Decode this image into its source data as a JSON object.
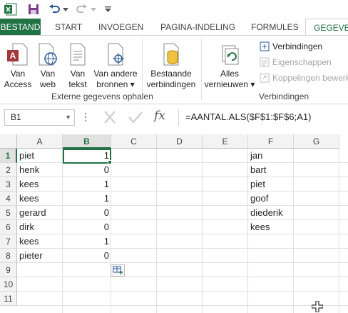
{
  "quick_access": {
    "icons": [
      "excel-icon",
      "save-icon",
      "undo-icon",
      "redo-icon",
      "customize-icon"
    ]
  },
  "tabs": [
    {
      "label": "BESTAND"
    },
    {
      "label": "START"
    },
    {
      "label": "INVOEGEN"
    },
    {
      "label": "PAGINA-INDELING"
    },
    {
      "label": "FORMULES"
    },
    {
      "label": "GEGEVEN"
    }
  ],
  "ribbon": {
    "van_access": [
      "Van",
      "Access"
    ],
    "van_web": [
      "Van",
      "web"
    ],
    "van_tekst": [
      "Van",
      "tekst"
    ],
    "van_andere": [
      "Van andere",
      "bronnen ▾"
    ],
    "bestaande": [
      "Bestaande",
      "verbindingen"
    ],
    "group_external": "Externe gegevens ophalen",
    "alles": [
      "Alles",
      "vernieuwen ▾"
    ],
    "verbindingen": "Verbindingen",
    "eigenschappen": "Eigenschappen",
    "koppelingen": "Koppelingen bewerk",
    "group_connections": "Verbindingen",
    "accent": "#217346"
  },
  "formula_bar": {
    "name_box": "B1",
    "formula": "=AANTAL.ALS($F$1:$F$6;A1)",
    "fx": "fx"
  },
  "grid": {
    "columns": [
      "A",
      "B",
      "C",
      "D",
      "E",
      "F",
      "G"
    ],
    "rows": [
      "1",
      "2",
      "3",
      "4",
      "5",
      "6",
      "7",
      "8",
      "9",
      "10",
      "11"
    ],
    "col_a": [
      "piet",
      "henk",
      "kees",
      "kees",
      "gerard",
      "dirk",
      "kees",
      "pieter"
    ],
    "col_b": [
      "1",
      "0",
      "1",
      "1",
      "0",
      "0",
      "1",
      "0"
    ],
    "col_f": [
      "jan",
      "bart",
      "piet",
      "goof",
      "diederik",
      "kees"
    ],
    "selected_cell": "B1"
  }
}
